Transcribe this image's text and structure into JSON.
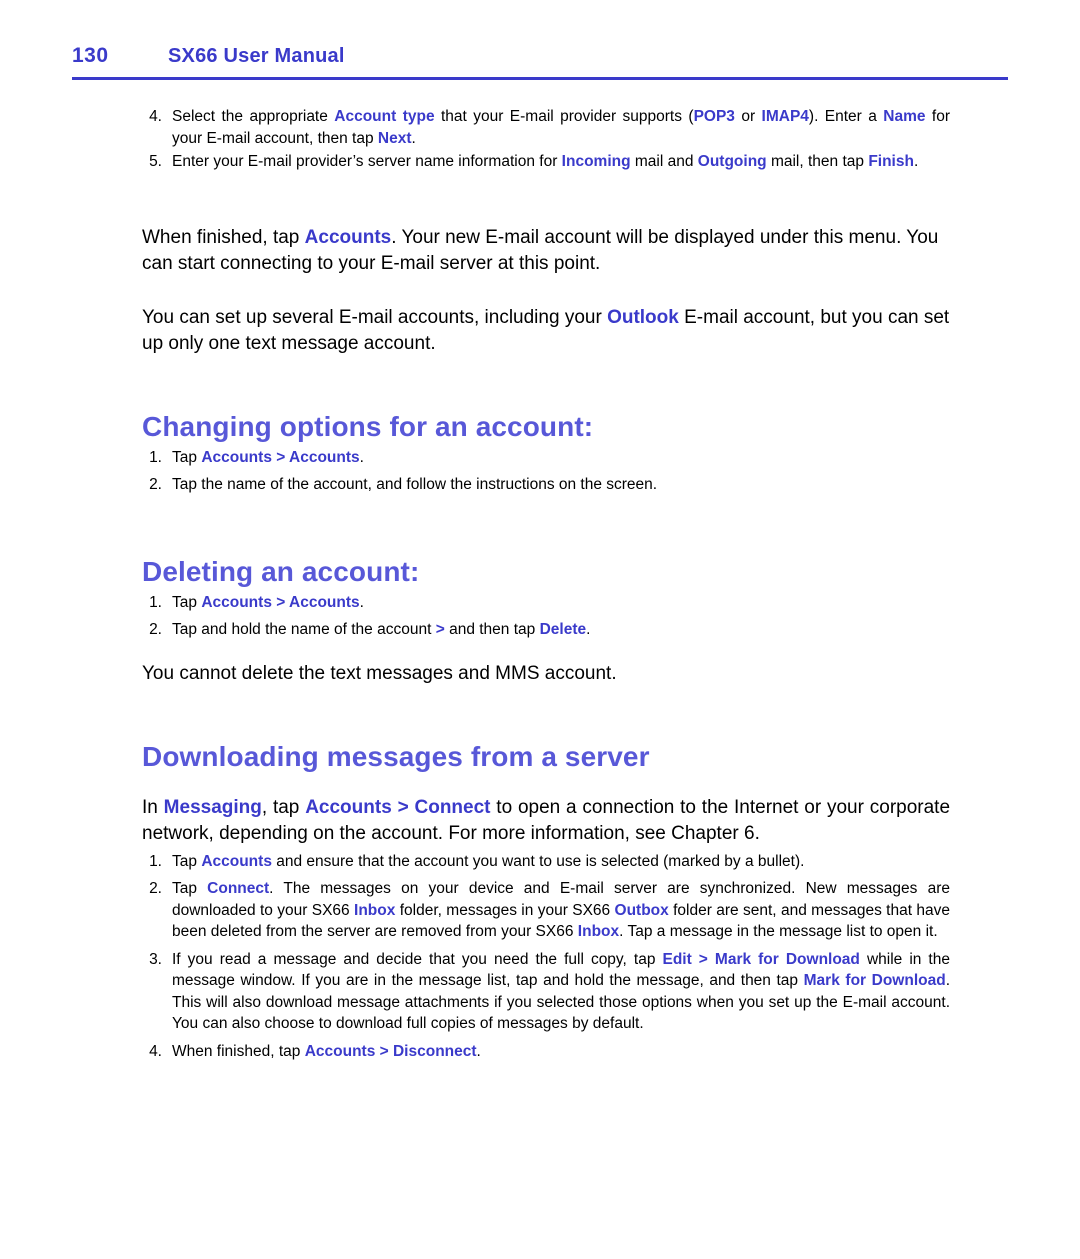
{
  "header": {
    "page_number": "130",
    "manual_title": "SX66 User Manual",
    "accent_color": "#3a3aca"
  },
  "top_list": [
    {
      "num": "4.",
      "parts": [
        {
          "t": "Select the appropriate ",
          "s": "plain"
        },
        {
          "t": "Account type",
          "s": "blue"
        },
        {
          "t": " that your E-mail provider supports (",
          "s": "plain"
        },
        {
          "t": "POP3",
          "s": "blue"
        },
        {
          "t": " or ",
          "s": "plain"
        },
        {
          "t": "IMAP4",
          "s": "blue"
        },
        {
          "t": "). Enter a ",
          "s": "plain"
        },
        {
          "t": "Name",
          "s": "blue"
        },
        {
          "t": " for your E-mail account, then tap ",
          "s": "plain"
        },
        {
          "t": "Next",
          "s": "blue"
        },
        {
          "t": ".",
          "s": "plain"
        }
      ]
    },
    {
      "num": "5.",
      "parts": [
        {
          "t": "Enter your E-mail provider’s server name information for ",
          "s": "plain"
        },
        {
          "t": "Incoming",
          "s": "blue"
        },
        {
          "t": " mail and ",
          "s": "plain"
        },
        {
          "t": "Outgoing",
          "s": "blue"
        },
        {
          "t": " mail, then tap ",
          "s": "plain"
        },
        {
          "t": "Finish",
          "s": "blue"
        },
        {
          "t": ".",
          "s": "plain"
        }
      ]
    }
  ],
  "para_1": [
    {
      "t": "When finished, tap ",
      "s": "plain"
    },
    {
      "t": "Accounts",
      "s": "blue"
    },
    {
      "t": ". Your new E-mail account will be displayed under this menu. You can start connecting to your E-mail server at this point.",
      "s": "plain"
    }
  ],
  "para_2": [
    {
      "t": "You can set up several E-mail accounts, including your ",
      "s": "plain"
    },
    {
      "t": "Outlook",
      "s": "blue"
    },
    {
      "t": " E-mail account, but you can set up only one text message account.",
      "s": "plain"
    }
  ],
  "section_changing": {
    "heading": "Changing options for an account:",
    "items": [
      {
        "num": "1.",
        "parts": [
          {
            "t": "Tap ",
            "s": "plain"
          },
          {
            "t": "Accounts > Accounts",
            "s": "blue"
          },
          {
            "t": ".",
            "s": "plain"
          }
        ]
      },
      {
        "num": "2.",
        "parts": [
          {
            "t": "Tap the name of the account, and follow the instructions on the screen.",
            "s": "plain"
          }
        ]
      }
    ]
  },
  "section_deleting": {
    "heading": "Deleting an account:",
    "items": [
      {
        "num": "1.",
        "parts": [
          {
            "t": "Tap ",
            "s": "plain"
          },
          {
            "t": "Accounts > Accounts",
            "s": "blue"
          },
          {
            "t": ".",
            "s": "plain"
          }
        ]
      },
      {
        "num": "2.",
        "parts": [
          {
            "t": "Tap and hold the name of the account ",
            "s": "plain"
          },
          {
            "t": ">",
            "s": "blue"
          },
          {
            "t": " and then tap ",
            "s": "plain"
          },
          {
            "t": "Delete",
            "s": "blue"
          },
          {
            "t": ".",
            "s": "plain"
          }
        ]
      }
    ],
    "note": [
      {
        "t": "You cannot delete the text messages and MMS account.",
        "s": "plain"
      }
    ]
  },
  "section_downloading": {
    "heading": "Downloading messages from a server",
    "intro": [
      {
        "t": "In ",
        "s": "plain"
      },
      {
        "t": "Messaging",
        "s": "blue"
      },
      {
        "t": ", tap ",
        "s": "plain"
      },
      {
        "t": "Accounts > Connect",
        "s": "blue"
      },
      {
        "t": " to open a connection to the Internet or your corporate network, depending on the account. For more information, see Chapter 6.",
        "s": "plain"
      }
    ],
    "items": [
      {
        "num": "1.",
        "parts": [
          {
            "t": "Tap ",
            "s": "plain"
          },
          {
            "t": "Accounts",
            "s": "blue"
          },
          {
            "t": " and ensure that the account you want to use is selected (marked by a bullet).",
            "s": "plain"
          }
        ]
      },
      {
        "num": "2.",
        "parts": [
          {
            "t": "Tap ",
            "s": "plain"
          },
          {
            "t": "Connect",
            "s": "blue"
          },
          {
            "t": ". The messages on your device and E-mail server are synchronized. New messages are downloaded to your SX66 ",
            "s": "plain"
          },
          {
            "t": "Inbox",
            "s": "blue"
          },
          {
            "t": " folder, messages in your SX66 ",
            "s": "plain"
          },
          {
            "t": "Outbox",
            "s": "blue"
          },
          {
            "t": " folder are sent, and messages that have been deleted from the server are removed from your SX66 ",
            "s": "plain"
          },
          {
            "t": "Inbox",
            "s": "blue"
          },
          {
            "t": ". Tap a message in the message list to open it.",
            "s": "plain"
          }
        ]
      },
      {
        "num": "3.",
        "parts": [
          {
            "t": "If you read a message and decide that you need the full copy, tap ",
            "s": "plain"
          },
          {
            "t": "Edit > Mark for Download",
            "s": "blue"
          },
          {
            "t": " while in the message window. If you are in the message list, tap and hold the message, and then tap ",
            "s": "plain"
          },
          {
            "t": "Mark for Download",
            "s": "blue"
          },
          {
            "t": ". This will also download message attachments if you selected those options when you set up the E-mail account. You can also choose to download full copies of messages by default.",
            "s": "plain"
          }
        ]
      },
      {
        "num": "4.",
        "parts": [
          {
            "t": "When finished, tap ",
            "s": "plain"
          },
          {
            "t": "Accounts > Disconnect",
            "s": "blue"
          },
          {
            "t": ".",
            "s": "plain"
          }
        ]
      }
    ]
  }
}
